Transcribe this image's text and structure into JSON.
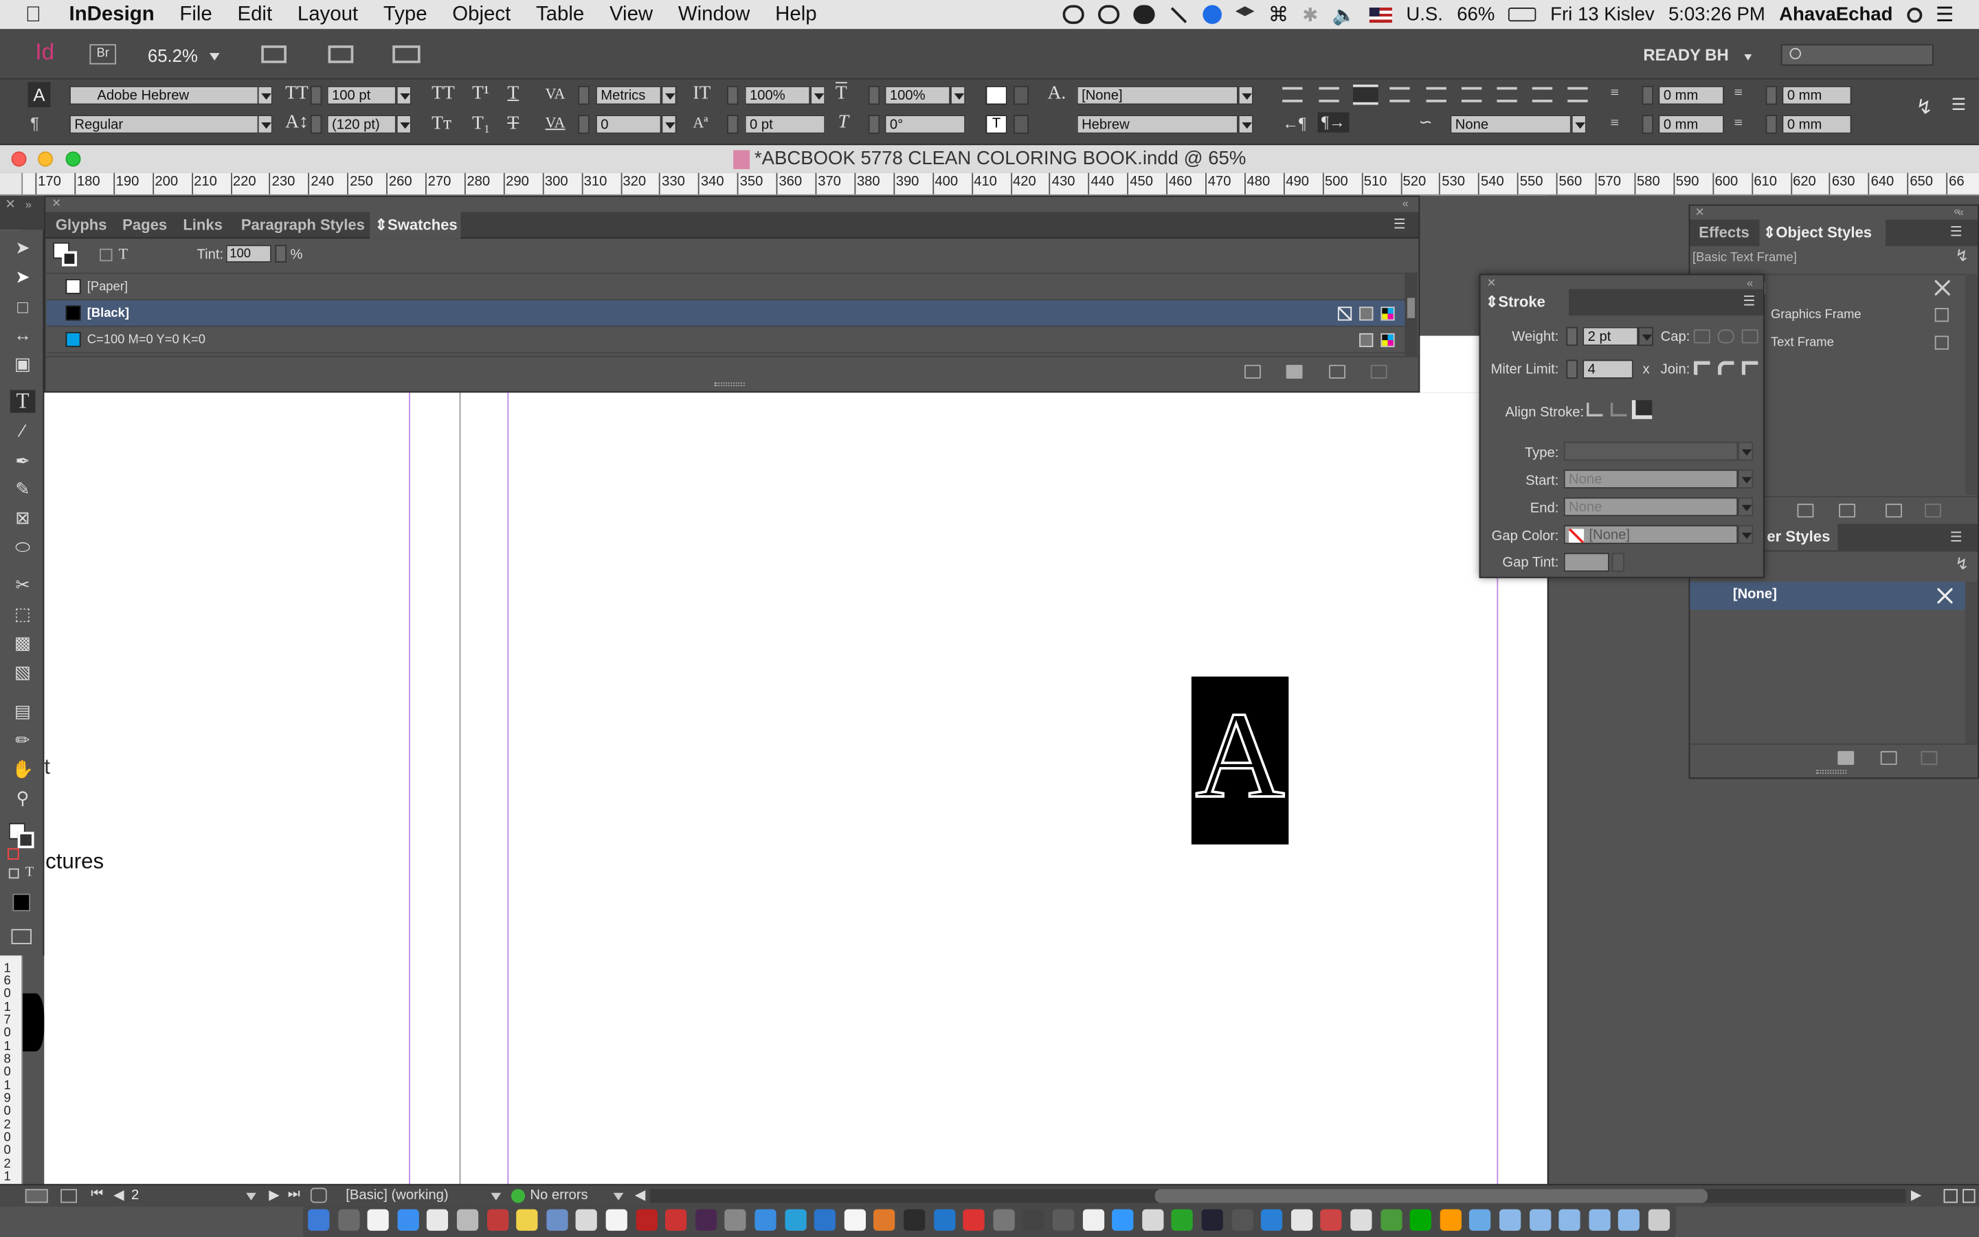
{
  "menubar": {
    "app": "InDesign",
    "items": [
      "File",
      "Edit",
      "Layout",
      "Type",
      "Object",
      "Table",
      "View",
      "Window",
      "Help"
    ],
    "status": {
      "flag": "U.S.",
      "battery": "66%",
      "date": "Fri 13 Kislev",
      "time": "5:03:26 PM",
      "user": "AhavaEchad"
    }
  },
  "appbar": {
    "logo": "Id",
    "bridge": "Br",
    "zoom": "65.2%",
    "workspace": "READY BH"
  },
  "control": {
    "font": "Adobe Hebrew",
    "style": "Regular",
    "size": "100 pt",
    "leading": "(120 pt)",
    "kerning": "Metrics",
    "tracking": "0",
    "vscale": "100%",
    "hscale": "100%",
    "baseline": "0 pt",
    "skew": "0°",
    "char_style": "[None]",
    "language": "Hebrew",
    "para_none": "None",
    "indent_left": "0 mm",
    "indent_right": "0 mm",
    "space_before": "0 mm",
    "space_after": "0 mm"
  },
  "document": {
    "title": "*ABCBOOK 5778 CLEAN COLORING BOOK.indd @ 65%"
  },
  "ruler": {
    "h_ticks": [
      "170",
      "180",
      "190",
      "200",
      "210",
      "220",
      "230",
      "240",
      "250",
      "260",
      "270",
      "280",
      "290",
      "300",
      "310",
      "320",
      "330",
      "340",
      "350",
      "360",
      "370",
      "380",
      "390",
      "400",
      "410",
      "420",
      "430",
      "440",
      "450",
      "460",
      "470",
      "480",
      "490",
      "500",
      "510",
      "520",
      "530",
      "540",
      "550",
      "560",
      "570",
      "580",
      "590",
      "600",
      "610",
      "620",
      "630",
      "640",
      "650",
      "66"
    ],
    "v_ticks": [
      "1\n6\n0",
      "1\n7\n0",
      "1\n8\n0",
      "1\n9\n0",
      "2\n0\n0",
      "2\n1"
    ]
  },
  "swatches_panel": {
    "tabs": [
      "Glyphs",
      "Pages",
      "Links",
      "Paragraph Styles",
      "Swatches"
    ],
    "tint_label": "Tint:",
    "tint_value": "100",
    "tint_unit": "%",
    "rows": [
      {
        "name": "[Paper]",
        "color": "#ffffff"
      },
      {
        "name": "[Black]",
        "color": "#000000"
      },
      {
        "name": "C=100 M=0 Y=0 K=0",
        "color": "#00a0e6"
      }
    ]
  },
  "stroke_panel": {
    "title": "Stroke",
    "weight_label": "Weight:",
    "weight": "2 pt",
    "cap_label": "Cap:",
    "miter_label": "Miter Limit:",
    "miter": "4",
    "x": "x",
    "join_label": "Join:",
    "align_label": "Align Stroke:",
    "type_label": "Type:",
    "start_label": "Start:",
    "start": "None",
    "end_label": "End:",
    "end": "None",
    "gapcolor_label": "Gap Color:",
    "gapcolor": "[None]",
    "gaptint_label": "Gap Tint:"
  },
  "right_panel": {
    "tabs": [
      "Effects",
      "Object Styles"
    ],
    "current": "[Basic Text Frame]",
    "items": [
      {
        "label": "]"
      },
      {
        "label": "Graphics Frame"
      },
      {
        "label": "Text Frame"
      }
    ],
    "second_title": "er Styles",
    "second_item": "[None]"
  },
  "canvas": {
    "glyph": "A",
    "side_text1": "t",
    "side_text2": "ctures"
  },
  "statusbar": {
    "page": "2",
    "style": "[Basic] (working)",
    "errors": "No errors"
  }
}
